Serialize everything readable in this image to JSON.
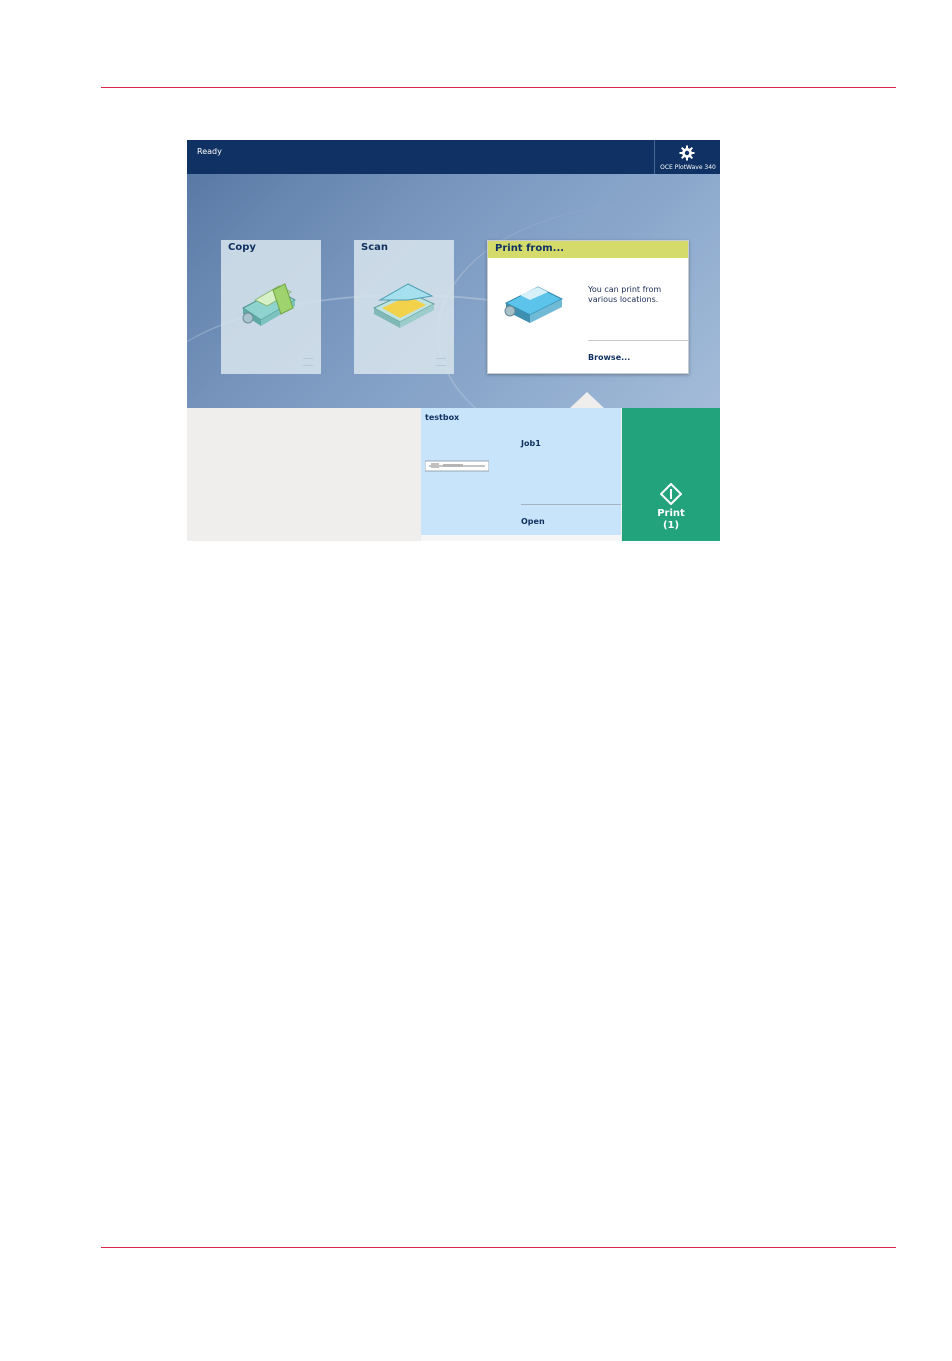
{
  "status": "Ready",
  "device": {
    "name": "OCE PlotWave 340"
  },
  "tiles": {
    "copy": {
      "title": "Copy"
    },
    "scan": {
      "title": "Scan"
    },
    "print_from": {
      "title": "Print from...",
      "description": "You can print from various locations.",
      "browse_label": "Browse..."
    }
  },
  "job": {
    "box": "testbox",
    "name": "Job1",
    "open_label": "Open"
  },
  "print_button": {
    "label": "Print",
    "count": "(1)"
  },
  "colors": {
    "topbar": "#0f3163",
    "accent_yellow": "#d4db6a",
    "job_bg": "#c7e4fa",
    "print_green": "#23a37b",
    "page_rule": "#d8264d"
  }
}
